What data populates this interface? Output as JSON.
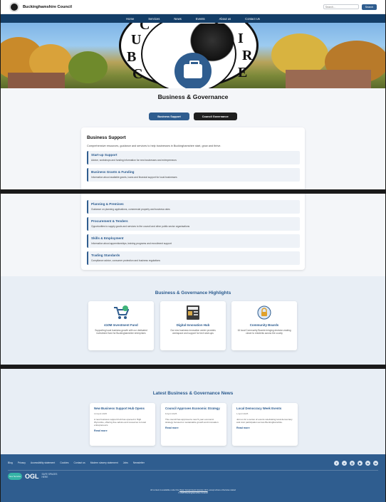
{
  "header": {
    "brand": "Buckinghamshire Council",
    "search_placeholder": "Search...",
    "search_button": "Search"
  },
  "nav": [
    "Home",
    "Services",
    "News",
    "Events",
    "About us",
    "Contact Us"
  ],
  "hero": {
    "seal_letters": [
      "B",
      "U",
      "C",
      "I",
      "R",
      "E",
      "C",
      "O"
    ]
  },
  "page": {
    "title": "Business & Governance",
    "tabs": [
      "Business Support",
      "Council Governance"
    ]
  },
  "business_support": {
    "title": "Business Support",
    "description": "Comprehensive resources, guidance and services to help businesses in Buckinghamshire start, grow and thrive.",
    "services": [
      {
        "title": "Start-up Support",
        "desc": "Advice, workshops and funding information for new businesses and entrepreneurs"
      },
      {
        "title": "Business Grants & Funding",
        "desc": "Information about available grants, loans and financial support for local businesses"
      },
      {
        "title": "Planning & Premises",
        "desc": "Guidance on planning applications, commercial property and business rates"
      },
      {
        "title": "Procurement & Tenders",
        "desc": "Opportunities to supply goods and services to the council and other public sector organisations"
      },
      {
        "title": "Skills & Employment",
        "desc": "Information about apprenticeships, training programs and recruitment support"
      },
      {
        "title": "Trading Standards",
        "desc": "Compliance advice, consumer protection and business regulations"
      }
    ]
  },
  "highlights": {
    "title": "Business & Governance Highlights",
    "items": [
      {
        "title": "£10M Investment Fund",
        "desc": "Supporting local business growth with our dedicated investment fund for Buckinghamshire enterprises",
        "icon": "cart-plus-icon"
      },
      {
        "title": "Digital Innovation Hub",
        "desc": "Our new business innovation center provides workspace and support for tech start-ups",
        "icon": "project-board-icon"
      },
      {
        "title": "Community Boards",
        "desc": "16 local Community Boards bringing decision-making closer to residents across the county",
        "icon": "lock-badge-icon"
      }
    ]
  },
  "news": {
    "title": "Latest Business & Governance News",
    "items": [
      {
        "title": "New Business Support Hub Opens",
        "date": "10 April 2025",
        "text": "A new business support hub has opened in High Wycombe, offering free advice and resources to local entrepreneurs.",
        "link": "Read more"
      },
      {
        "title": "Council Approves Economic Strategy",
        "date": "8 April 2025",
        "text": "The council has approved a new 5-year economic strategy focused on sustainable growth and innovation.",
        "link": "Read more"
      },
      {
        "title": "Local Democracy Week Events",
        "date": "1 April 2025",
        "text": "Join us for a series of events celebrating local democracy and civic participation across Buckinghamshire.",
        "link": "Read more"
      }
    ]
  },
  "footer": {
    "links": [
      "Blog",
      "Privacy",
      "Accessibility statement",
      "Cookies",
      "Contact us",
      "Modern slavery statement",
      "Jobs",
      "Newsletter"
    ],
    "socials": [
      "f",
      "x",
      "◎",
      "▶",
      "in",
      "in"
    ],
    "logo_gov": "Gov Service",
    "logo_ogl": "OGL",
    "logo_safe_1": "SAFE SPACES",
    "logo_safe_2": "HERE",
    "note_prefix": "All content is available under the ",
    "note_link": "Open Government Licence v3.0",
    "note_suffix": ", except where otherwise stated",
    "copyright": "© 2025 Buckinghamshire Council"
  }
}
